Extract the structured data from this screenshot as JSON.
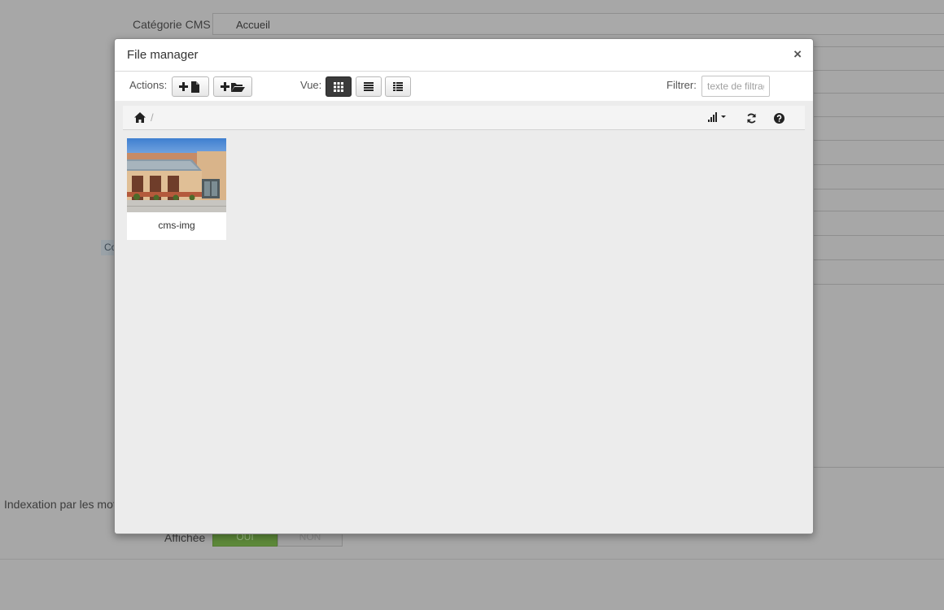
{
  "background": {
    "category_label": "Catégorie CMS",
    "category_value": "Accueil",
    "tab_fragment": "Co",
    "seo_label": "Indexation par les mot",
    "display_label": "Affichée",
    "toggle_on": "OUI",
    "toggle_off": "NON"
  },
  "modal": {
    "title": "File manager",
    "close": "×"
  },
  "toolbar": {
    "actions_label": "Actions:",
    "view_label": "Vue:",
    "filter_label": "Filtrer:",
    "filter_placeholder": "texte de filtrage"
  },
  "breadcrumb": {
    "separator": "/"
  },
  "files": [
    {
      "name": "cms-img"
    }
  ],
  "colors": {
    "overlay": "#a7a7a7",
    "active_view": "#3a3a3a",
    "content_bg": "#ececec",
    "toggle_on": "#5e8a3a"
  }
}
